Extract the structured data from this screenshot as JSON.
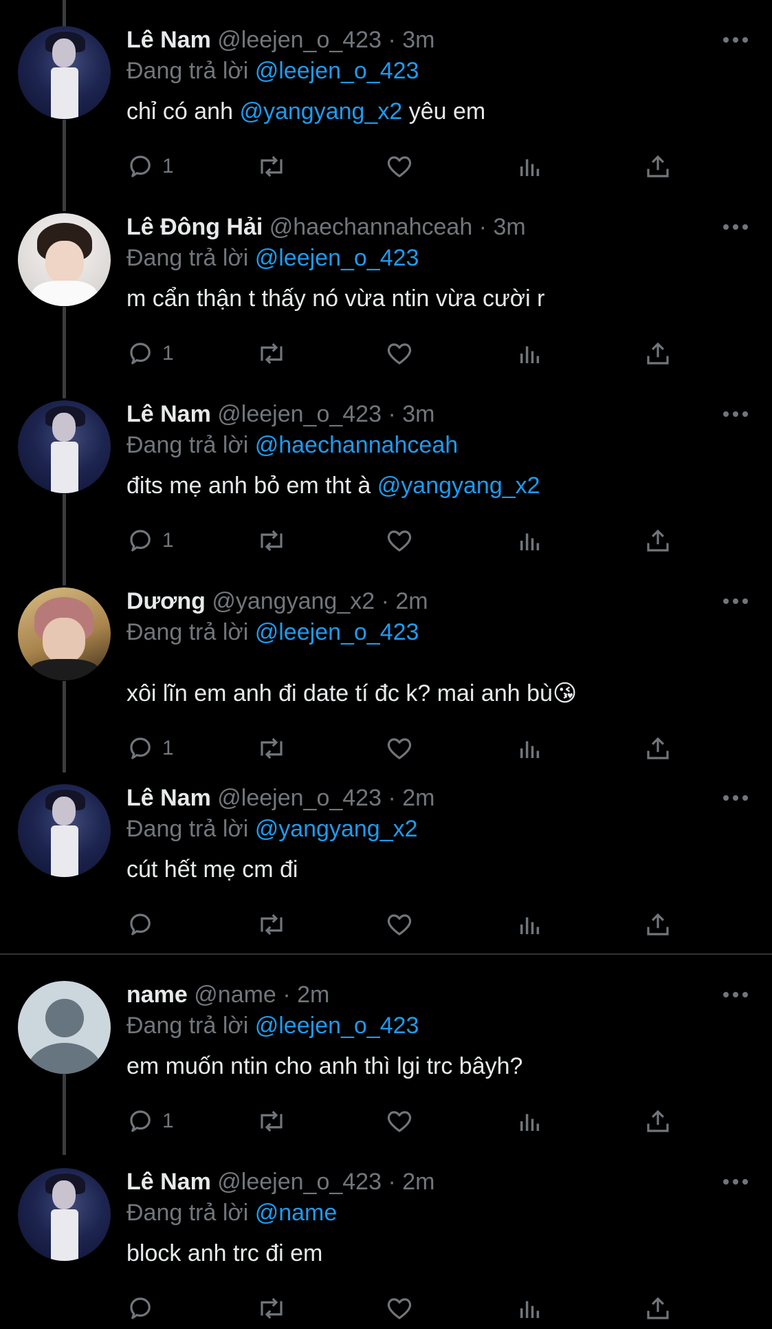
{
  "replying_prefix": "Đang trả lời",
  "dot": "·",
  "tweets": [
    {
      "name": "Lê Nam",
      "handle": "@leejen_o_423",
      "time": "3m",
      "replying_to": "@leejen_o_423",
      "text_parts": [
        "chỉ có anh ",
        "@yangyang_x2",
        " yêu em"
      ],
      "reply_count": "1",
      "avatar": "avatar-lenam"
    },
    {
      "name": "Lê Đông Hải",
      "handle": "@haechannahceah",
      "time": "3m",
      "replying_to": "@leejen_o_423",
      "text_parts": [
        "m cẩn thận t thấy nó vừa ntin vừa cười r"
      ],
      "reply_count": "1",
      "avatar": "avatar-lednghai"
    },
    {
      "name": "Lê Nam",
      "handle": "@leejen_o_423",
      "time": "3m",
      "replying_to": "@haechannahceah",
      "text_parts": [
        "đits mẹ anh bỏ em tht à ",
        "@yangyang_x2"
      ],
      "reply_count": "1",
      "avatar": "avatar-lenam"
    },
    {
      "name": "Dương",
      "handle": "@yangyang_x2",
      "time": "2m",
      "replying_to": "@leejen_o_423",
      "text_parts": [
        "xôi lĩn em anh đi date tí đc k? mai anh bù😘"
      ],
      "reply_count": "1",
      "avatar": "avatar-duong"
    },
    {
      "name": "Lê Nam",
      "handle": "@leejen_o_423",
      "time": "2m",
      "replying_to": "@yangyang_x2",
      "text_parts": [
        "cút hết mẹ cm đi"
      ],
      "reply_count": "",
      "avatar": "avatar-lenam"
    },
    {
      "name": "name",
      "handle": "@name",
      "time": "2m",
      "replying_to": "@leejen_o_423",
      "text_parts": [
        "em muốn ntin cho anh thì lgi trc bâyh?"
      ],
      "reply_count": "1",
      "avatar": "avatar-default"
    },
    {
      "name": "Lê Nam",
      "handle": "@leejen_o_423",
      "time": "2m",
      "replying_to": "@name",
      "text_parts": [
        "block anh trc đi em"
      ],
      "reply_count": "",
      "avatar": "avatar-lenam"
    }
  ],
  "colors": {
    "background": "#000000",
    "text": "#e7e9ea",
    "muted": "#71767b",
    "mention": "#1d9bf0",
    "divider": "#2f3336"
  },
  "icons": [
    "reply-icon",
    "retweet-icon",
    "like-icon",
    "analytics-icon",
    "share-icon",
    "more-icon"
  ]
}
